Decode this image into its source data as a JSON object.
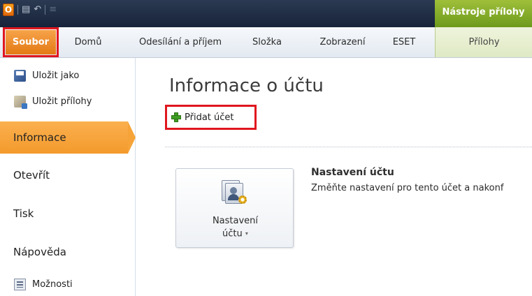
{
  "titlebar": {
    "app_icon_letter": "O",
    "context_title": "Nástroje přílohy"
  },
  "tabs": {
    "file": "Soubor",
    "home": "Domů",
    "send_receive": "Odesílání a příjem",
    "folder": "Složka",
    "view": "Zobrazení",
    "eset": "ESET",
    "attachments": "Přílohy"
  },
  "backstage": {
    "commands": {
      "save_as": "Uložit jako",
      "save_attachments": "Uložit přílohy",
      "options": "Možnosti"
    },
    "nav": {
      "info": "Informace",
      "open": "Otevřít",
      "print": "Tisk",
      "help": "Nápověda"
    }
  },
  "main": {
    "title": "Informace o účtu",
    "add_account": "Přidat účet",
    "settings_button": {
      "line1": "Nastavení",
      "line2": "účtu",
      "arrow": "▾"
    },
    "section": {
      "heading": "Nastavení účtu",
      "description": "Změňte nastavení pro tento účet a nakonf"
    }
  },
  "colors": {
    "file_tab": "#e37a14",
    "active_nav": "#f6a43a",
    "highlight_border": "#e0161e",
    "context_green": "#7ea726"
  }
}
